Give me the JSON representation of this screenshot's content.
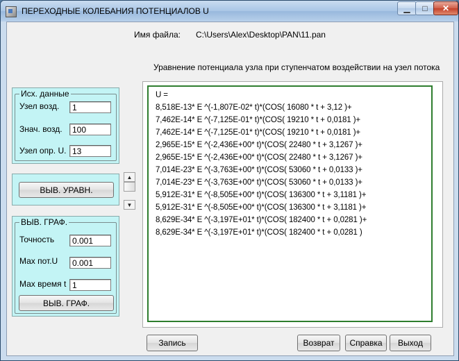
{
  "window": {
    "title": "ПЕРЕХОДНЫЕ КОЛЕБАНИЯ ПОТЕНЦИАЛОВ  U",
    "minimize_glyph": "▁",
    "maximize_glyph": "□",
    "close_glyph": "✕"
  },
  "file": {
    "label": "Имя файла:",
    "path": "C:\\Users\\Alex\\Desktop\\PAN\\11.pan"
  },
  "caption": "Уравнение  потенциала  узла  при ступенчатом воздействии на узел   потока",
  "input_group": {
    "title": "Исх. данные",
    "fields": [
      {
        "label": "Узел  возд.",
        "value": "1"
      },
      {
        "label": "Знач. возд.",
        "value": "100"
      },
      {
        "label": "Узел опр. U.",
        "value": "13"
      }
    ]
  },
  "show_equation_button": "ВЫВ. УРАВН.",
  "graph_group": {
    "title": "ВЫВ. ГРАФ.",
    "fields": [
      {
        "label": "Точность",
        "value": "0.001"
      },
      {
        "label": "Мах пот.U",
        "value": "0.001"
      },
      {
        "label": "Мах время t",
        "value": "1"
      }
    ],
    "button": "ВЫВ. ГРАФ."
  },
  "spinner": {
    "up_glyph": "▲",
    "down_glyph": "▼"
  },
  "output_lines": [
    "U =",
    "8,518E-13* E  ^(-1,807E-02* t)*(COS( 16080 * t + 3,12 )+",
    "7,462E-14* E  ^(-7,125E-01* t)*(COS( 19210 * t + 0,0181 )+",
    "7,462E-14* E  ^(-7,125E-01* t)*(COS( 19210 * t + 0,0181 )+",
    "2,965E-15* E  ^(-2,436E+00* t)*(COS( 22480 * t + 3,1267 )+",
    "2,965E-15* E  ^(-2,436E+00* t)*(COS( 22480 * t + 3,1267 )+",
    "7,014E-23* E  ^(-3,763E+00* t)*(COS( 53060 * t + 0,0133 )+",
    "7,014E-23* E  ^(-3,763E+00* t)*(COS( 53060 * t + 0,0133 )+",
    "5,912E-31* E  ^(-8,505E+00* t)*(COS( 136300 * t + 3,1181 )+",
    "5,912E-31* E  ^(-8,505E+00* t)*(COS( 136300 * t + 3,1181 )+",
    "8,629E-34* E  ^(-3,197E+01* t)*(COS( 182400 * t + 0,0281 )+",
    "8,629E-34* E  ^(-3,197E+01* t)*(COS( 182400 * t + 0,0281 )"
  ],
  "bottom_buttons": {
    "save": "Запись",
    "back": "Возврат",
    "help": "Справка",
    "exit": "Выход"
  },
  "colors": {
    "panel": "#c3f4f5",
    "output_border": "#2e7d2e"
  }
}
